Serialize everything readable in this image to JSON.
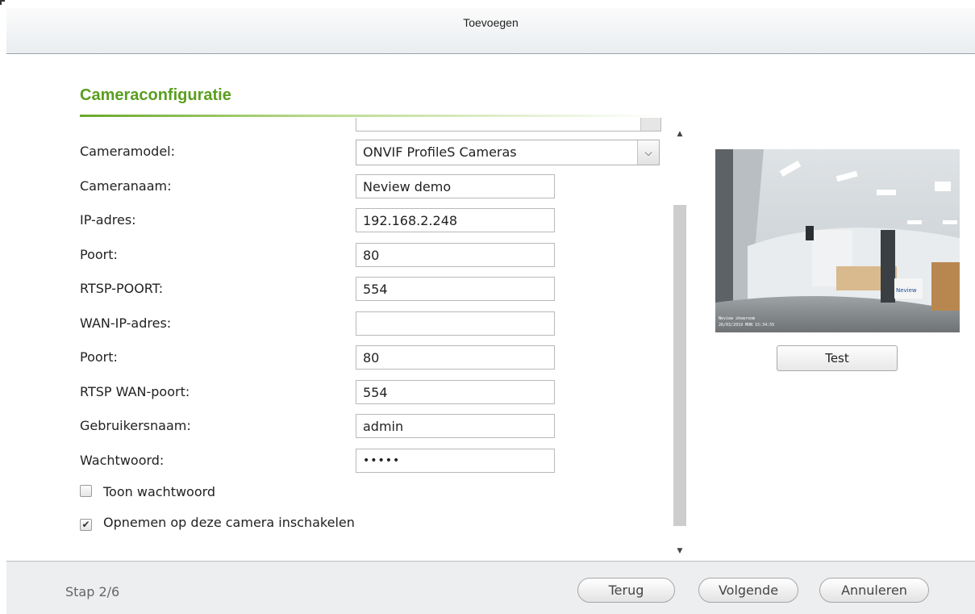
{
  "dialog": {
    "title": "Toevoegen"
  },
  "section": {
    "title": "Cameraconfiguratie"
  },
  "form": {
    "camera_model": {
      "label": "Cameramodel:",
      "value": "ONVIF ProfileS Cameras"
    },
    "camera_name": {
      "label": "Cameranaam:",
      "value": "Neview demo"
    },
    "ip_address": {
      "label": "IP-adres:",
      "value": "192.168.2.248"
    },
    "port": {
      "label": "Poort:",
      "value": "80"
    },
    "rtsp_port": {
      "label": "RTSP-POORT:",
      "value": "554"
    },
    "wan_ip": {
      "label": "WAN-IP-adres:",
      "value": ""
    },
    "wan_port": {
      "label": "Poort:",
      "value": "80"
    },
    "rtsp_wan_port": {
      "label": "RTSP WAN-poort:",
      "value": "554"
    },
    "username": {
      "label": "Gebruikersnaam:",
      "value": "admin"
    },
    "password": {
      "label": "Wachtwoord:",
      "value": "•••••"
    },
    "show_password": {
      "label": "Toon wachtwoord",
      "checked": false
    },
    "enable_recording": {
      "label": "Opnemen op deze camera inschakelen",
      "checked": true
    }
  },
  "preview": {
    "overlay_text": "Neview",
    "camera_timestamp_line1": "Neview showroom",
    "camera_timestamp_line2": "26/03/2019 MON 15:34:55"
  },
  "buttons": {
    "test": "Test",
    "back": "Terug",
    "next": "Volgende",
    "cancel": "Annuleren"
  },
  "footer": {
    "step": "Stap 2/6"
  },
  "colors": {
    "accent": "#5a9e1e",
    "footer_bg": "#edeeef"
  },
  "icons": {
    "select_arrow": "chevron-down-icon",
    "checkbox_checked": "check-icon"
  }
}
